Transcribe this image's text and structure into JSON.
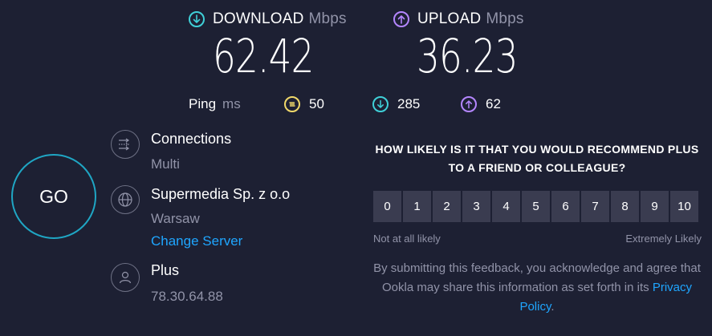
{
  "download": {
    "label": "DOWNLOAD",
    "unit": "Mbps",
    "value": "62.42",
    "icon": "download-arrow-icon",
    "color": "#3fd0d8"
  },
  "upload": {
    "label": "UPLOAD",
    "unit": "Mbps",
    "value": "36.23",
    "icon": "upload-arrow-icon",
    "color": "#b486ff"
  },
  "ping": {
    "label": "Ping",
    "unit": "ms",
    "idle": "50",
    "download": "285",
    "upload": "62",
    "idle_color": "#f0d86a"
  },
  "go_label": "GO",
  "connections": {
    "title": "Connections",
    "value": "Multi",
    "icon": "connections-icon"
  },
  "server": {
    "title": "Supermedia Sp. z o.o",
    "location": "Warsaw",
    "change_label": "Change Server",
    "icon": "globe-icon"
  },
  "provider": {
    "title": "Plus",
    "ip": "78.30.64.88",
    "icon": "user-icon"
  },
  "survey": {
    "question": "HOW LIKELY IS IT THAT YOU WOULD RECOMMEND PLUS TO A FRIEND OR COLLEAGUE?",
    "scale": [
      "0",
      "1",
      "2",
      "3",
      "4",
      "5",
      "6",
      "7",
      "8",
      "9",
      "10"
    ],
    "low_label": "Not at all likely",
    "high_label": "Extremely Likely",
    "disclaimer_prefix": "By submitting this feedback, you acknowledge and agree that Ookla may share this information as set forth in its ",
    "privacy_link": "Privacy Policy",
    "disclaimer_suffix": "."
  }
}
